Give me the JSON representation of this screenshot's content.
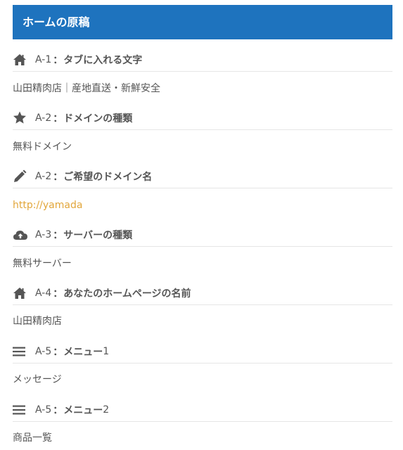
{
  "header": {
    "title": "ホームの原稿"
  },
  "sections": [
    {
      "icon": "home-icon",
      "code": "A-1",
      "label": "タブに入れる文字",
      "suffix": "",
      "value": "山田精肉店｜産地直送・新鮮安全"
    },
    {
      "icon": "star-icon",
      "code": "A-2",
      "label": "ドメインの種類",
      "suffix": "",
      "value": "無料ドメイン"
    },
    {
      "icon": "pencil-icon",
      "code": "A-2",
      "label": "ご希望のドメイン名",
      "suffix": "",
      "value": "http://yamada"
    },
    {
      "icon": "cloud-upload-icon",
      "code": "A-3",
      "label": "サーバーの種類",
      "suffix": "",
      "value": "無料サーバー"
    },
    {
      "icon": "home-icon",
      "code": "A-4",
      "label": "あなたのホームページの名前",
      "suffix": "",
      "value": "山田精肉店"
    },
    {
      "icon": "menu-icon",
      "code": "A-5",
      "label": "メニュー",
      "suffix": "1",
      "value": "メッセージ"
    },
    {
      "icon": "menu-icon",
      "code": "A-5",
      "label": "メニュー",
      "suffix": "2",
      "value": "商品一覧"
    }
  ],
  "colors": {
    "header_bg": "#1e73be",
    "link": "#e2a63a",
    "text": "#555555"
  }
}
